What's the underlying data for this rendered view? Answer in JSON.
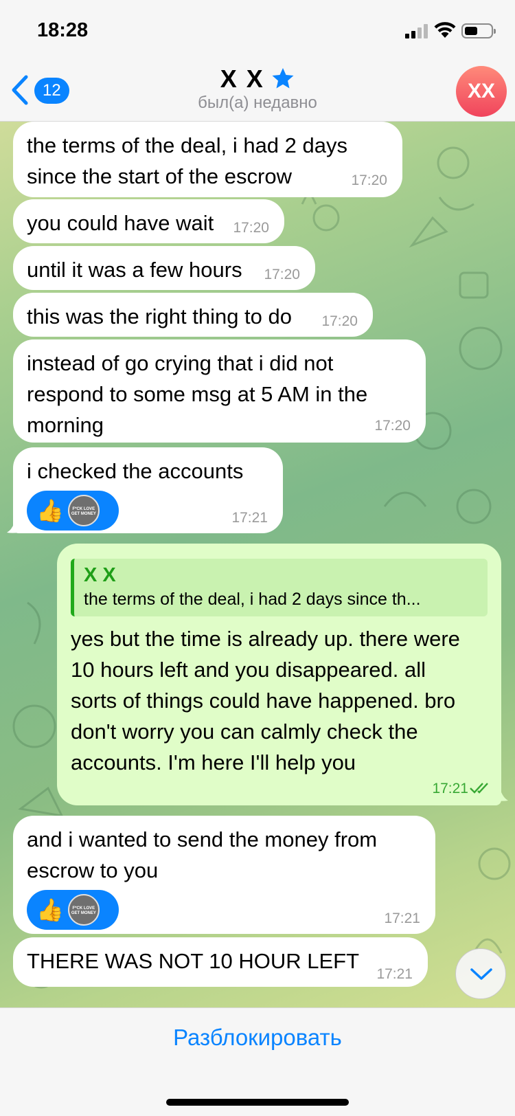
{
  "status_bar": {
    "time": "18:28"
  },
  "header": {
    "back_count": "12",
    "title": "X X",
    "subtitle": "был(а) недавно",
    "avatar_initials": "XX"
  },
  "messages": [
    {
      "text": "the terms of the deal, i had 2 days since the start of the escrow",
      "time": "17:20"
    },
    {
      "text": "you could have wait",
      "time": "17:20"
    },
    {
      "text": "until it was a few hours",
      "time": "17:20"
    },
    {
      "text": "this was the right thing to do",
      "time": "17:20"
    },
    {
      "text": "instead of go crying that i did not respond to some msg at 5 AM in the morning",
      "time": "17:20"
    },
    {
      "text": "i checked the accounts",
      "time": "17:21",
      "reaction_emoji": "👍"
    },
    {
      "reply_name": "X X",
      "reply_text": "the terms of the deal, i had 2 days since th...",
      "text": "yes but the time is already up. there were 10 hours left and you disappeared. all sorts of things could have happened. bro don't worry you can calmly check the accounts. I'm here I'll help you",
      "time": "17:21"
    },
    {
      "text": "and i wanted to send the money from escrow to you",
      "time": "17:21",
      "reaction_emoji": "👍"
    },
    {
      "text": "THERE WAS NOT 10 HOUR LEFT",
      "time": "17:21"
    }
  ],
  "reaction_avatar_text": "F*CK LOVE GET MONEY",
  "bottom": {
    "unblock_label": "Разблокировать"
  },
  "colors": {
    "accent": "#0a84ff",
    "outgoing_bubble": "#e0fdc8",
    "incoming_bubble": "#ffffff",
    "read_ticks": "#38a834"
  }
}
